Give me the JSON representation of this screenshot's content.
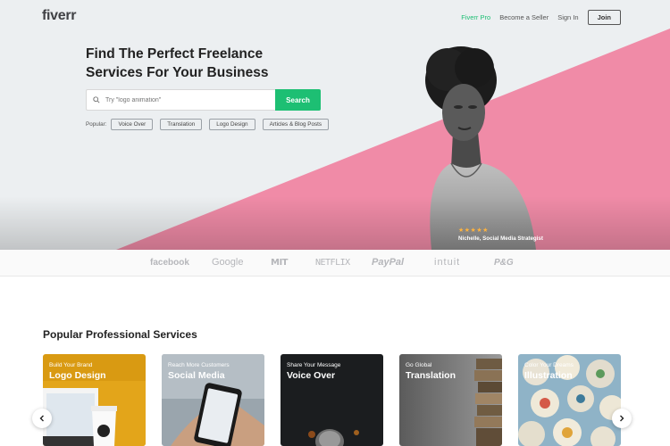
{
  "header": {
    "logo": "fiverr",
    "nav": {
      "fiverr_pro": "Fiverr Pro",
      "become_seller": "Become a Seller",
      "sign_in": "Sign In",
      "join": "Join"
    }
  },
  "hero": {
    "headline": "Find The Perfect Freelance Services For Your Business",
    "search": {
      "placeholder": "Try \"logo animation\"",
      "button": "Search"
    },
    "popular": {
      "label": "Popular:",
      "tags": [
        "Voice Over",
        "Translation",
        "Logo Design",
        "Articles & Blog Posts"
      ]
    },
    "testimonial": {
      "stars": "★★★★★",
      "caption": "Nichelle, Social Media Strategist",
      "rating": 5
    }
  },
  "trusted_by": {
    "brands": [
      "facebook",
      "Google",
      "MIT",
      "NETFLIX",
      "PayPal",
      "intuit",
      "P&G"
    ]
  },
  "services": {
    "title": "Popular Professional Services",
    "cards": [
      {
        "subtitle": "Build Your Brand",
        "title": "Logo Design"
      },
      {
        "subtitle": "Reach More Customers",
        "title": "Social Media"
      },
      {
        "subtitle": "Share Your Message",
        "title": "Voice Over"
      },
      {
        "subtitle": "Go Global",
        "title": "Translation"
      },
      {
        "subtitle": "Color Your Dreams",
        "title": "Illustration"
      }
    ]
  },
  "icons": {
    "search": "search-icon",
    "prev": "chevron-left-icon",
    "next": "chevron-right-icon"
  },
  "colors": {
    "brand_green": "#1dbf73",
    "hero_pink": "#f08ba7",
    "hero_bg": "#eceff1",
    "star": "#ffb33e"
  }
}
